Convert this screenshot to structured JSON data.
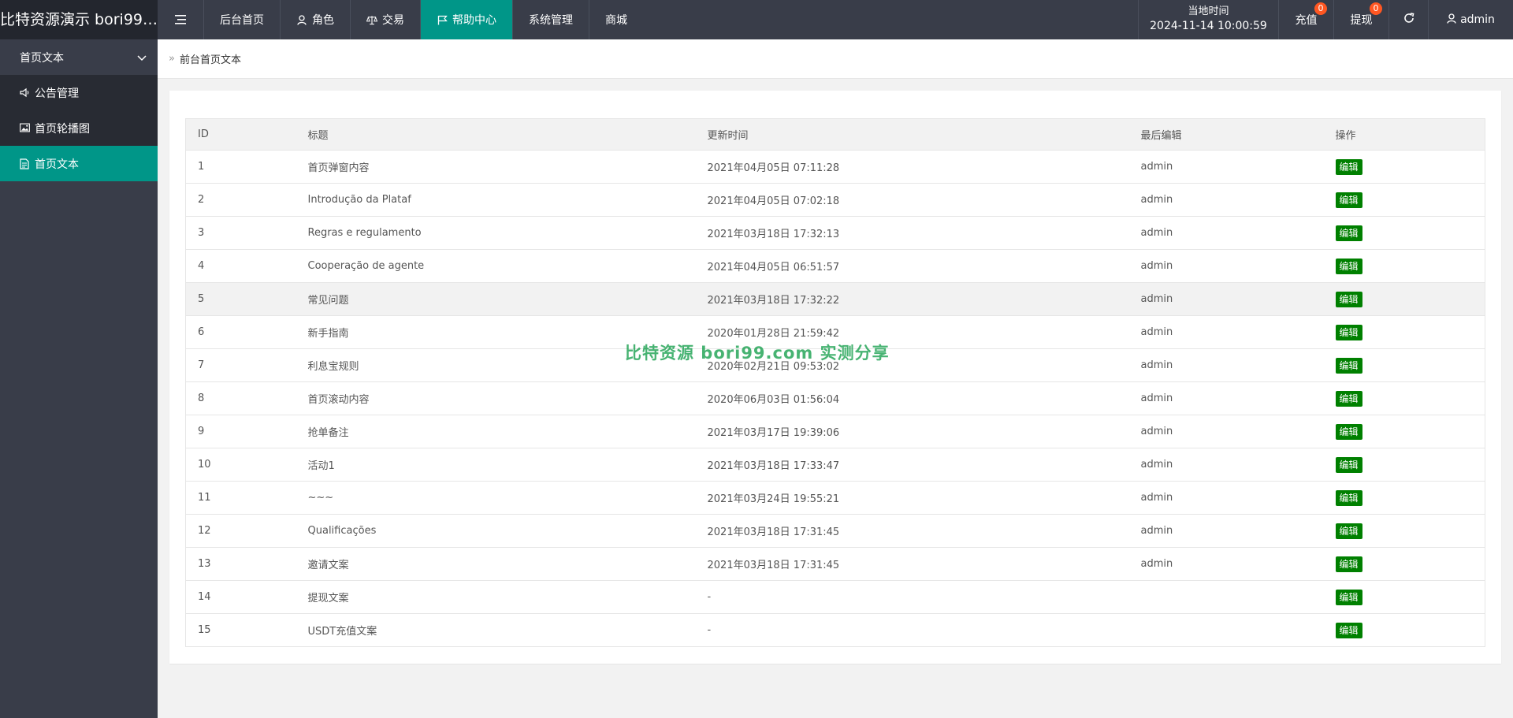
{
  "header": {
    "brand": "比特资源演示 bori99.c...",
    "nav": [
      {
        "label": "",
        "icon": "menu-icon"
      },
      {
        "label": "后台首页",
        "icon": ""
      },
      {
        "label": "角色",
        "icon": "user-icon"
      },
      {
        "label": "交易",
        "icon": "scale-icon"
      },
      {
        "label": "帮助中心",
        "icon": "flag-icon"
      },
      {
        "label": "系统管理",
        "icon": ""
      },
      {
        "label": "商城",
        "icon": ""
      }
    ],
    "active_nav": "帮助中心",
    "clock": {
      "label": "当地时间",
      "value": "2024-11-14 10:00:59"
    },
    "recharge": {
      "label": "充值",
      "badge": "0"
    },
    "withdraw": {
      "label": "提现",
      "badge": "0"
    },
    "refresh_icon": "refresh-icon",
    "user": {
      "label": "admin",
      "icon": "user-icon"
    }
  },
  "sidebar": {
    "group": {
      "label": "首页文本",
      "icon": "chevron-down-icon"
    },
    "items": [
      {
        "label": "公告管理",
        "icon": "speaker-icon"
      },
      {
        "label": "首页轮播图",
        "icon": "image-icon"
      },
      {
        "label": "首页文本",
        "icon": "document-icon",
        "active": true
      }
    ]
  },
  "breadcrumb": {
    "current": "前台首页文本",
    "icon": "double-chevron-right-icon"
  },
  "table": {
    "headers": [
      "ID",
      "标题",
      "更新时间",
      "最后编辑",
      "操作"
    ],
    "action_label": "编辑",
    "rows": [
      {
        "id": "1",
        "title": "首页弹窗内容",
        "time": "2021年04月05日 07:11:28",
        "editor": "admin"
      },
      {
        "id": "2",
        "title": "Introdução da Plataf",
        "time": "2021年04月05日 07:02:18",
        "editor": "admin"
      },
      {
        "id": "3",
        "title": "Regras e regulamento",
        "time": "2021年03月18日 17:32:13",
        "editor": "admin"
      },
      {
        "id": "4",
        "title": "Cooperação de agente",
        "time": "2021年04月05日 06:51:57",
        "editor": "admin"
      },
      {
        "id": "5",
        "title": "常见问题",
        "time": "2021年03月18日 17:32:22",
        "editor": "admin"
      },
      {
        "id": "6",
        "title": "新手指南",
        "time": "2020年01月28日 21:59:42",
        "editor": "admin"
      },
      {
        "id": "7",
        "title": "利息宝规则",
        "time": "2020年02月21日 09:53:02",
        "editor": "admin"
      },
      {
        "id": "8",
        "title": "首页滚动内容",
        "time": "2020年06月03日 01:56:04",
        "editor": "admin"
      },
      {
        "id": "9",
        "title": "抢单备注",
        "time": "2021年03月17日 19:39:06",
        "editor": "admin"
      },
      {
        "id": "10",
        "title": "活动1",
        "time": "2021年03月18日 17:33:47",
        "editor": "admin"
      },
      {
        "id": "11",
        "title": "~~~",
        "time": "2021年03月24日 19:55:21",
        "editor": "admin"
      },
      {
        "id": "12",
        "title": "Qualificações",
        "time": "2021年03月18日 17:31:45",
        "editor": "admin"
      },
      {
        "id": "13",
        "title": "邀请文案",
        "time": "2021年03月18日 17:31:45",
        "editor": "admin"
      },
      {
        "id": "14",
        "title": "提现文案",
        "time": "-",
        "editor": ""
      },
      {
        "id": "15",
        "title": "USDT充值文案",
        "time": "-",
        "editor": ""
      }
    ]
  },
  "watermark": "比特资源 bori99.com 实测分享",
  "colors": {
    "header_bg": "#393d49",
    "accent": "#009688",
    "edit_button": "#008000",
    "badge": "#ff5722"
  }
}
